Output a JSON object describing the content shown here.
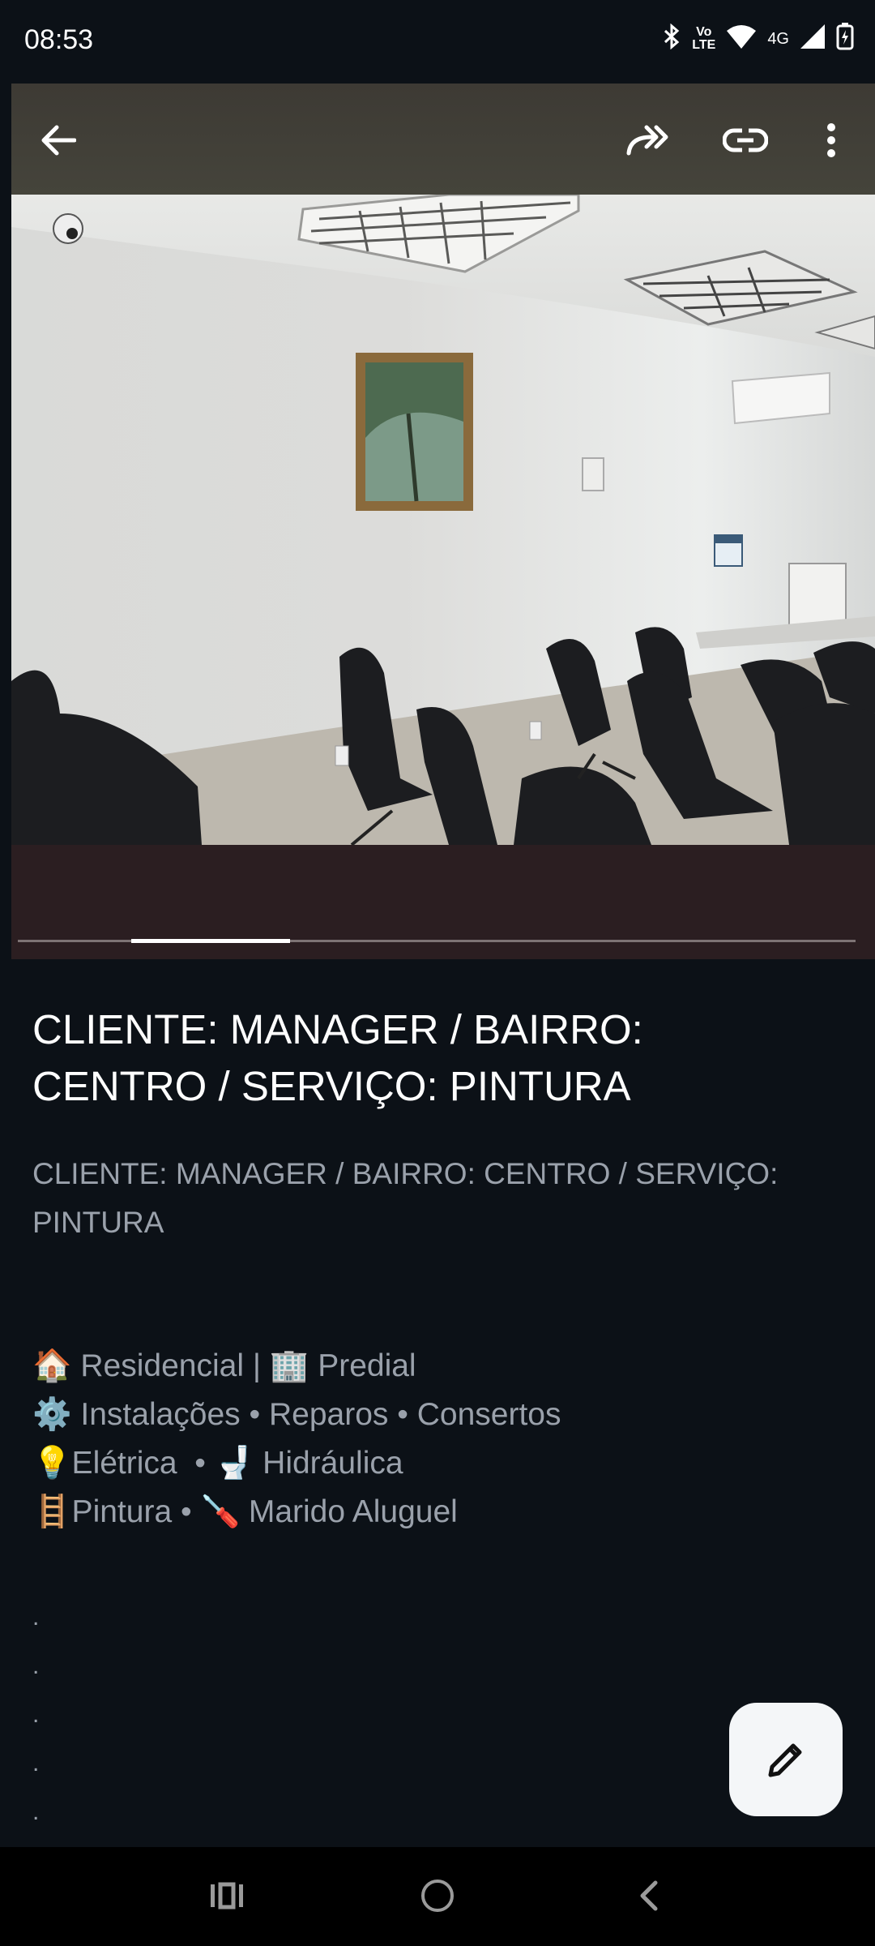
{
  "status_bar": {
    "time": "08:53",
    "icons": [
      "bluetooth-icon",
      "volte-icon",
      "wifi-icon",
      "4g-icon",
      "signal-icon",
      "battery-charging-icon"
    ],
    "volte_label": "Vo\nLTE",
    "network_label": "4G"
  },
  "toolbar": {
    "back_icon": "arrow-left-icon",
    "share_icon": "share-forward-icon",
    "link_icon": "link-icon",
    "menu_icon": "more-vert-icon"
  },
  "gallery": {
    "progress": 0.19,
    "progress_offset": 0.135
  },
  "post": {
    "title": "CLIENTE: MANAGER / BAIRRO: CENTRO / SERVIÇO: PINTURA",
    "subtitle": "CLIENTE: MANAGER / BAIRRO: CENTRO / SERVIÇO: PINTURA",
    "description_lines": [
      "🏠 Residencial | 🏢 Predial",
      "⚙️ Instalações • Reparos • Consertos",
      "💡Elétrica  • 🚽 Hidráulica",
      "🪜Pintura • 🪛 Marido Aluguel"
    ],
    "trailing_dots": [
      ".",
      ".",
      ".",
      ".",
      "."
    ]
  },
  "fab": {
    "icon": "pencil-edit-icon"
  },
  "nav_bar": {
    "recents_icon": "recents-icon",
    "home_icon": "home-circle-icon",
    "back_icon": "chevron-back-icon"
  },
  "colors": {
    "background": "#0c1117",
    "hero_bottom": "#2b1e21",
    "title": "#ffffff",
    "body_text": "#9aa1ab",
    "fab": "#f4f6f8"
  }
}
